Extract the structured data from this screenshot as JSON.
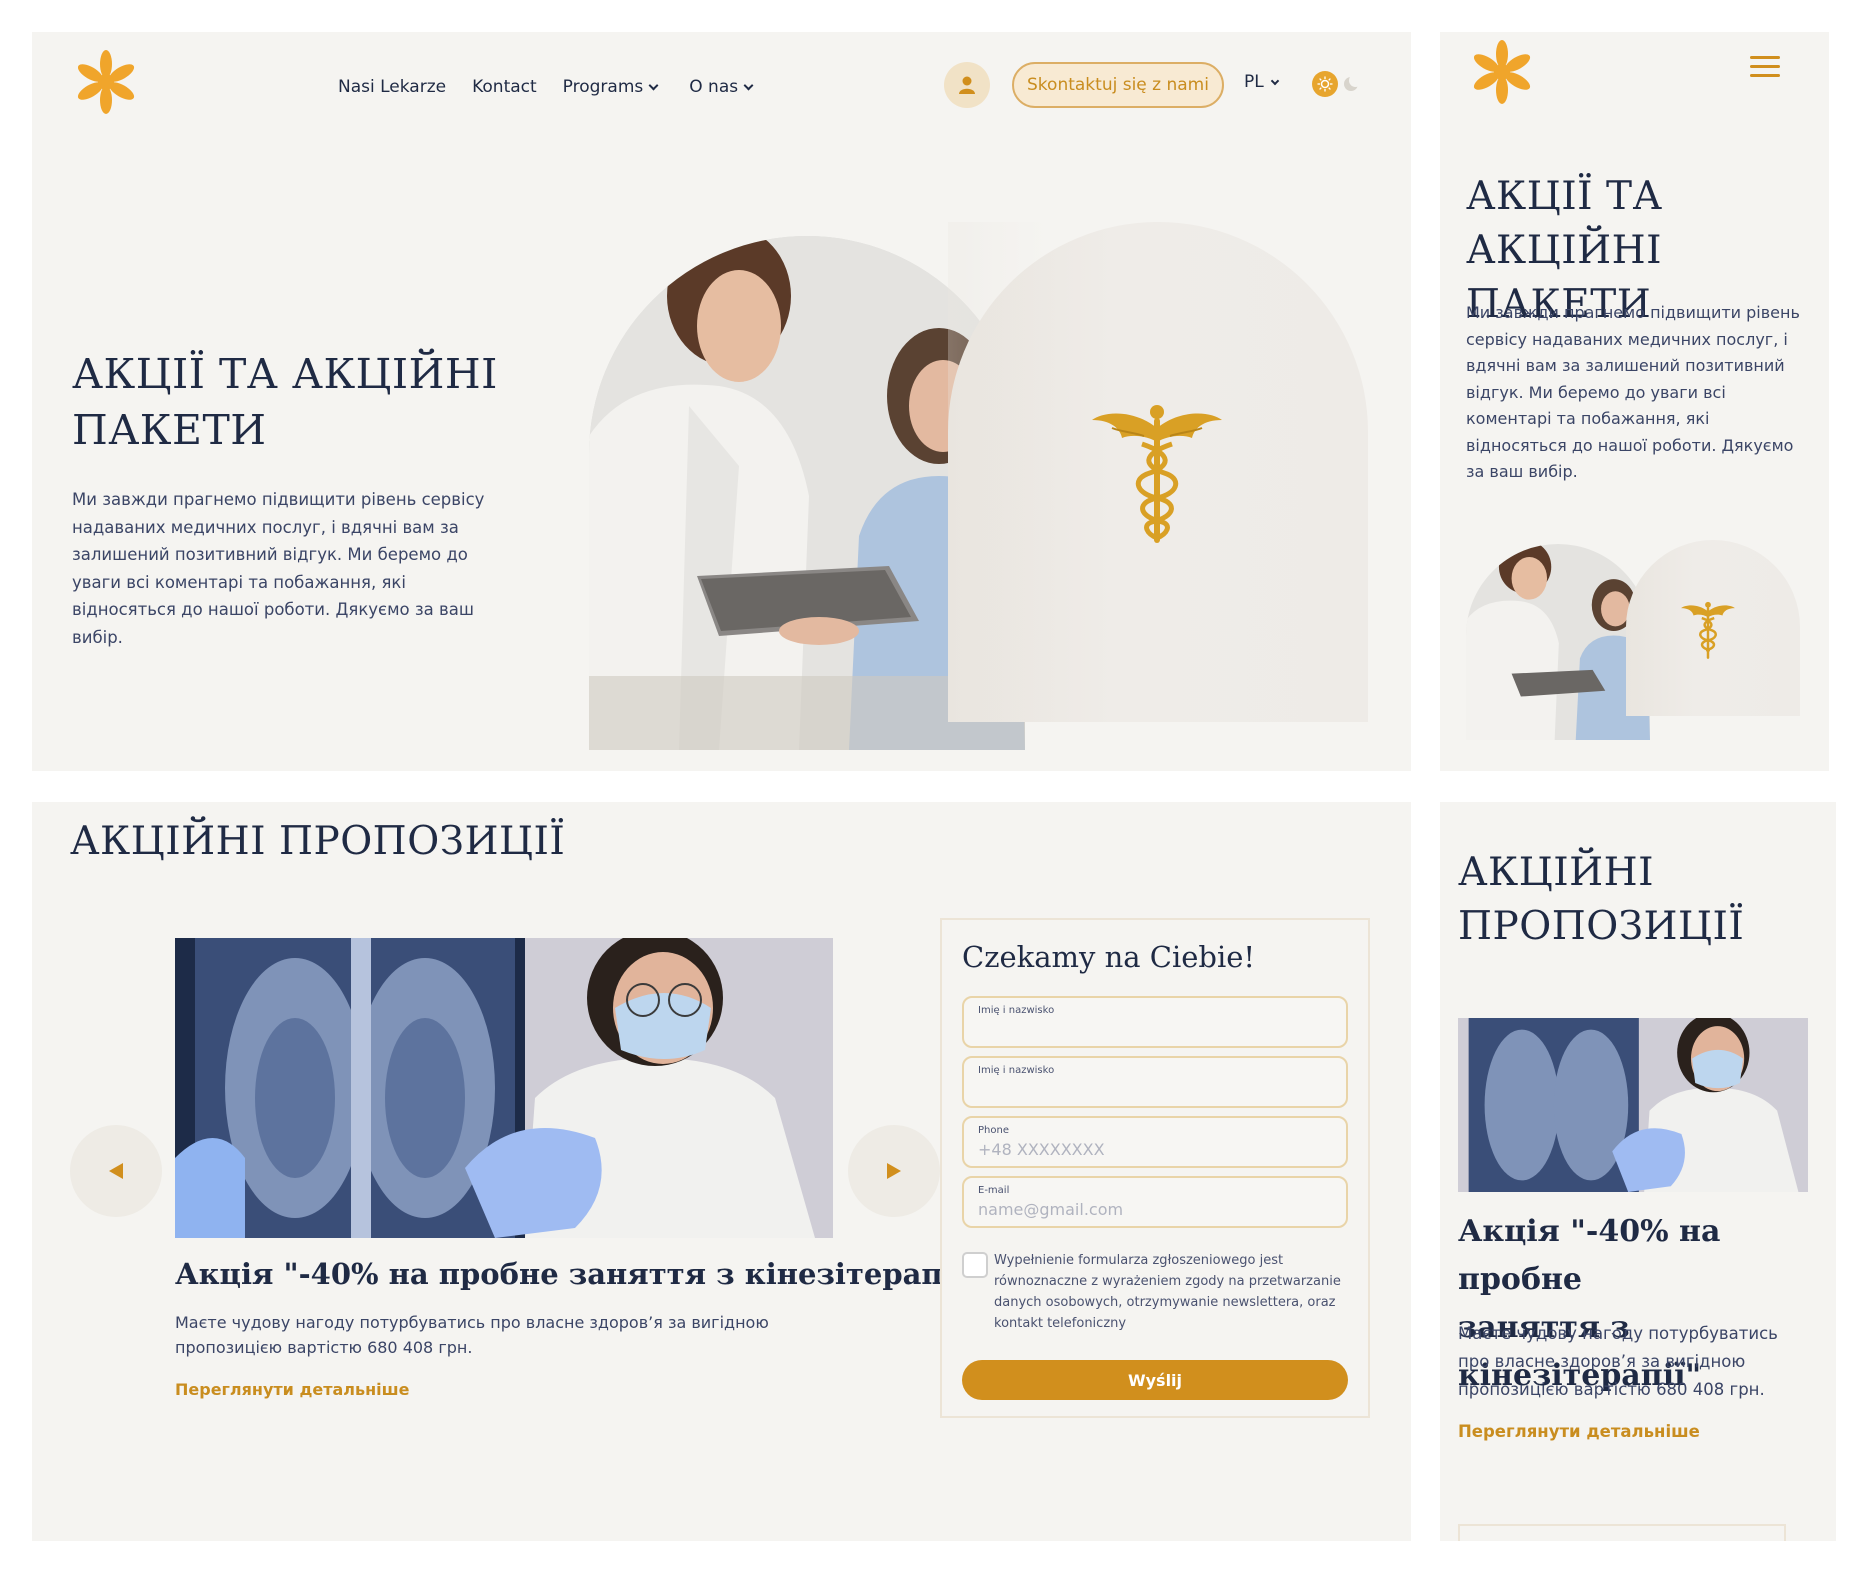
{
  "header": {
    "nav": [
      "Nasi Lekarze",
      "Kontact",
      "Programs",
      "O nas"
    ],
    "contact_button": "Skontaktuj się z nami",
    "language": "PL"
  },
  "hero": {
    "title_line1": "АКЦІЇ ТА АКЦІЙНІ",
    "title_line2": "ПАКЕТИ",
    "text": "Ми завжди прагнемо підвищити рівень сервісу надаваних медичних послуг, і вдячні вам за залишений позитивний відгук. Ми беремо до уваги всі коментарі та побажання, які відносяться до нашої роботи. Дякуємо за ваш вибір."
  },
  "promotions": {
    "title": "АКЦІЙНІ ПРОПОЗИЦІЇ",
    "title_mobile_line1": "АКЦІЙНІ",
    "title_mobile_line2": "ПРОПОЗИЦІЇ",
    "card": {
      "title": "Акція \"-40% на пробне заняття з кінезітерапії\"",
      "title_mobile_line1": "Акція \"-40% на пробне",
      "title_mobile_line2": "заняття з кінезітерапії\"",
      "text": "Маєте чудову нагоду потурбуватись про власне здоров’я за вигідною пропозицією вартістю 680 408 грн.",
      "link": "Переглянути детальніше"
    }
  },
  "form": {
    "title": "Czekamy na Ciebie!",
    "fields": [
      {
        "label": "Imię i nazwisko",
        "placeholder": ""
      },
      {
        "label": "Imię i nazwisko",
        "placeholder": ""
      },
      {
        "label": "Phone",
        "placeholder": "+48 XXXXXXXX"
      },
      {
        "label": "E-mail",
        "placeholder": "name@gmail.com"
      }
    ],
    "consent": "Wypełnienie formularza zgłoszeniowego jest równoznaczne z wyrażeniem zgody na przetwarzanie danych osobowych, otrzymywanie newslettera, oraz kontakt telefoniczny",
    "submit": "Wyślij"
  },
  "colors": {
    "accent": "#d18f1d",
    "background": "#f5f4f1",
    "heading": "#1f2a44"
  }
}
